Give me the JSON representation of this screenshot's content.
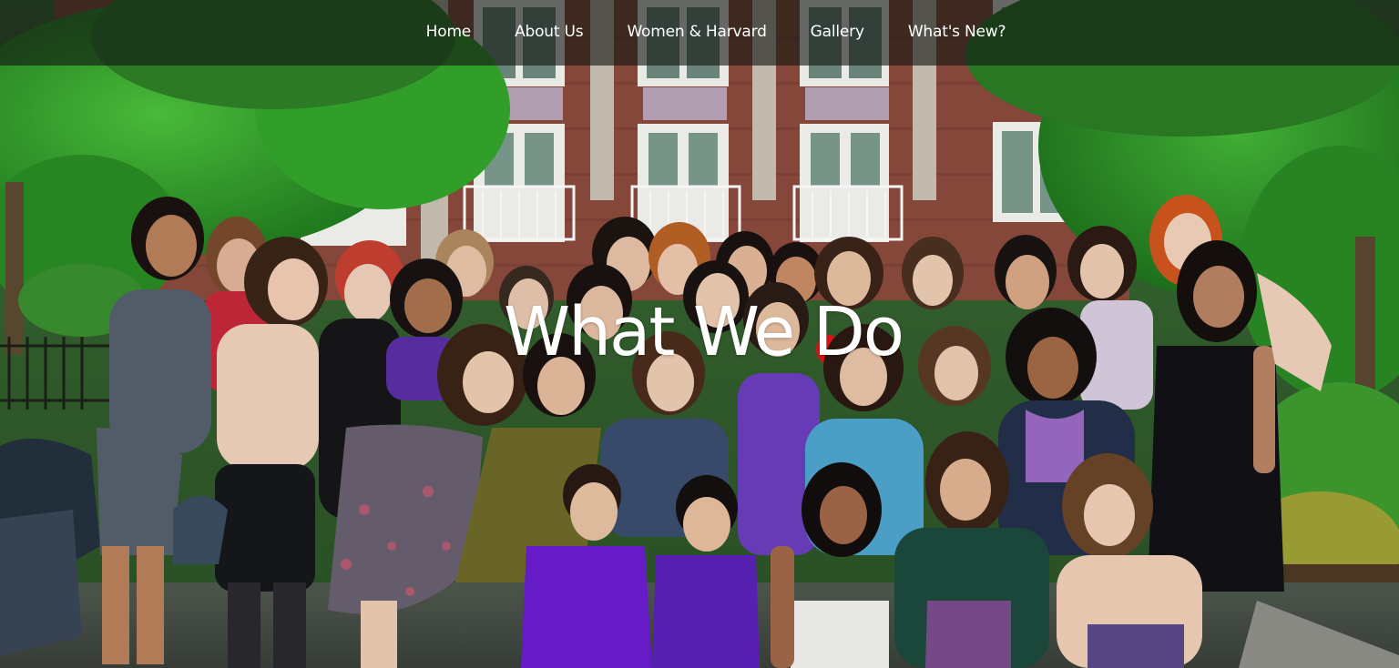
{
  "nav": {
    "items": [
      {
        "label": "Home"
      },
      {
        "label": "About Us"
      },
      {
        "label": "Women & Harvard"
      },
      {
        "label": "Gallery"
      },
      {
        "label": "What's New?"
      }
    ]
  },
  "hero": {
    "title": "What We Do"
  },
  "colors": {
    "nav_bar": "#121612",
    "nav_text": "#ffffff",
    "title_text": "#ffffff",
    "foliage": "#2f9a2a",
    "brick": "#8a4a3c"
  }
}
